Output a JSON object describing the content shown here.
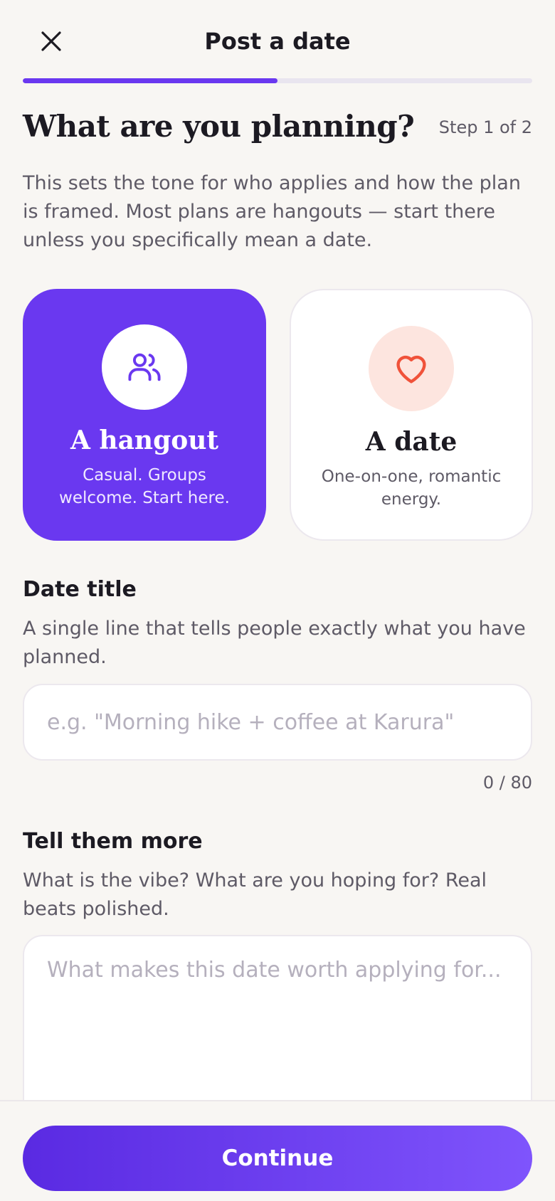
{
  "header": {
    "title": "Post a date",
    "close_icon": "close-icon"
  },
  "progress": {
    "fraction": 0.5,
    "color": "#6a38f0"
  },
  "step": {
    "heading": "What are you planning?",
    "label": "Step 1 of 2",
    "intro": "This sets the tone for who applies and how the plan is framed. Most plans are hangouts — start there unless you specifically mean a date."
  },
  "types": [
    {
      "title": "A hangout",
      "subtitle": "Casual. Groups welcome. Start here.",
      "icon": "users-icon",
      "selected": true
    },
    {
      "title": "A date",
      "subtitle": "One-on-one, romantic energy.",
      "icon": "heart-icon",
      "selected": false
    }
  ],
  "title_field": {
    "label": "Date title",
    "help": "A single line that tells people exactly what you have planned.",
    "value": "",
    "placeholder": "e.g. \"Morning hike + coffee at Karura\"",
    "counter": "0 / 80"
  },
  "details_field": {
    "label": "Tell them more",
    "help": "What is the vibe? What are you hoping for? Real beats polished.",
    "value": "",
    "placeholder": "What makes this date worth applying for..."
  },
  "footer": {
    "continue_label": "Continue"
  },
  "colors": {
    "accent": "#6a38f0",
    "background": "#f8f6f3",
    "heart": "#f0523a",
    "heart_bg": "#fde5df"
  }
}
